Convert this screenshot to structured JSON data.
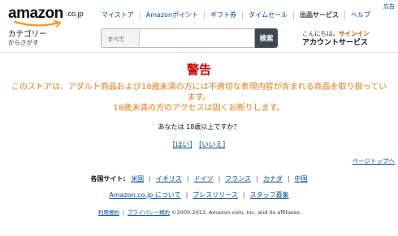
{
  "header": {
    "logo_word": "amazon",
    "logo_tld": ".co.jp",
    "ad_label": "広告",
    "nav": [
      {
        "label": "マイストア"
      },
      {
        "label": "Amazonポイント"
      },
      {
        "label": "ギフト券"
      },
      {
        "label": "タイムセール"
      },
      {
        "label": "出品サービス"
      },
      {
        "label": "ヘルプ"
      }
    ],
    "category_title": "カテゴリー",
    "category_subtitle": "からさがす",
    "search_scope": "すべて",
    "search_input_value": "",
    "search_button": "検索",
    "greeting": "こんにちは。",
    "signin": "サインイン",
    "account_services": "アカウントサービス"
  },
  "warning": {
    "title": "警告",
    "line1": "このストアは、アダルト商品および18歳未満の方には不適切な表現内容が含まれる商品を取り扱ってい",
    "line2": "ます。",
    "line3": "18歳未満の方のアクセスは固くお断りします。",
    "question": "あなたは 18歳以上ですか？",
    "yes": "[はい]",
    "no": "[いいえ]",
    "pagetop": "ページトップへ"
  },
  "footer": {
    "sites_label": "各国サイト:",
    "sites": [
      "米国",
      "イギリス",
      "ドイツ",
      "フランス",
      "カナダ",
      "中国"
    ],
    "links": [
      "Amazon.co.jp について",
      "プレスリリース",
      "スタッフ募集"
    ],
    "terms": "利用規約",
    "privacy": "プライバシー規約",
    "copyright": "©2000-2013, Amazon.com, Inc. and its affiliates"
  },
  "colors": {
    "link": "#004b91",
    "warning_title": "#cc0000",
    "warning_text": "#e47911",
    "signin": "#c45500",
    "search_button": "#3d4853"
  }
}
